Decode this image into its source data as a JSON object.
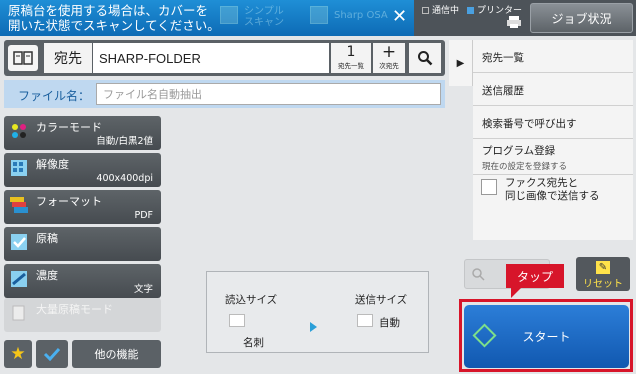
{
  "notice": {
    "text": "原稿台を使用する場合は、カバーを\n開いた状態でスキャンしてください。",
    "ghost_item_1": "シンプル\nスキャン",
    "ghost_item_2": "Sharp OSA"
  },
  "status": {
    "comm": "通信中",
    "printer": "プリンター"
  },
  "header": {
    "job_status": "ジョブ状況"
  },
  "address": {
    "label": "宛先",
    "value": "SHARP-FOLDER",
    "count": "1",
    "count_caption": "宛先一覧",
    "next_caption": "次宛先"
  },
  "file": {
    "label": "ファイル名：",
    "placeholder": "ファイル名自動抽出"
  },
  "settings": [
    {
      "label": "カラーモード",
      "value": "自動/白黒2値"
    },
    {
      "label": "解像度",
      "value": "400x400dpi"
    },
    {
      "label": "フォーマット",
      "value": "PDF"
    },
    {
      "label": "原稿",
      "value": ""
    },
    {
      "label": "濃度",
      "value": "文字"
    },
    {
      "label": "大量原稿モード",
      "value": ""
    }
  ],
  "bottom": {
    "other_functions": "他の機能"
  },
  "size": {
    "read_label": "読込サイズ",
    "send_label": "送信サイズ",
    "read_value": "名刺",
    "send_value": "自動"
  },
  "menu": {
    "dest_list": "宛先一覧",
    "send_history": "送信履歴",
    "search_number": "検索番号で呼び出す",
    "program_register": "プログラム登録",
    "program_sub": "現在の設定を登録する",
    "fax_same": "ファクス宛先と\n同じ画像で送信する"
  },
  "actions": {
    "reset": "リセット",
    "start": "スタート",
    "tap": "タップ"
  },
  "colors": {
    "accent_blue": "#1d78c8",
    "highlight_red": "#d7152a"
  }
}
